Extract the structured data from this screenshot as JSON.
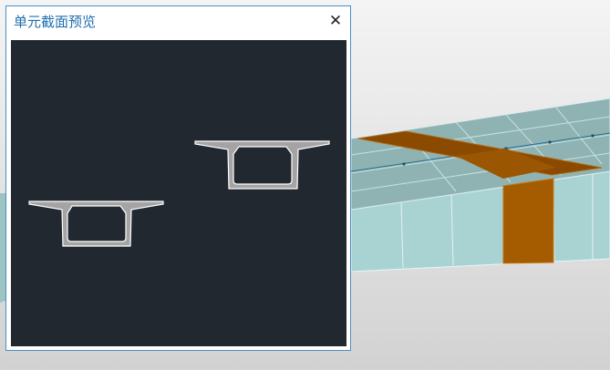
{
  "dialog": {
    "title": "单元截面预览",
    "close_glyph": "✕"
  },
  "colors": {
    "deck_highlight": "#8a4a00",
    "pier_highlight": "#a55b00",
    "deck_surface": "#8fb3b3",
    "side_face": "#a9d3d3",
    "preview_background": "#212830",
    "section_fill": "#a4a4a4",
    "section_edge": "#ffffff",
    "title_color": "#1f6fb0"
  }
}
